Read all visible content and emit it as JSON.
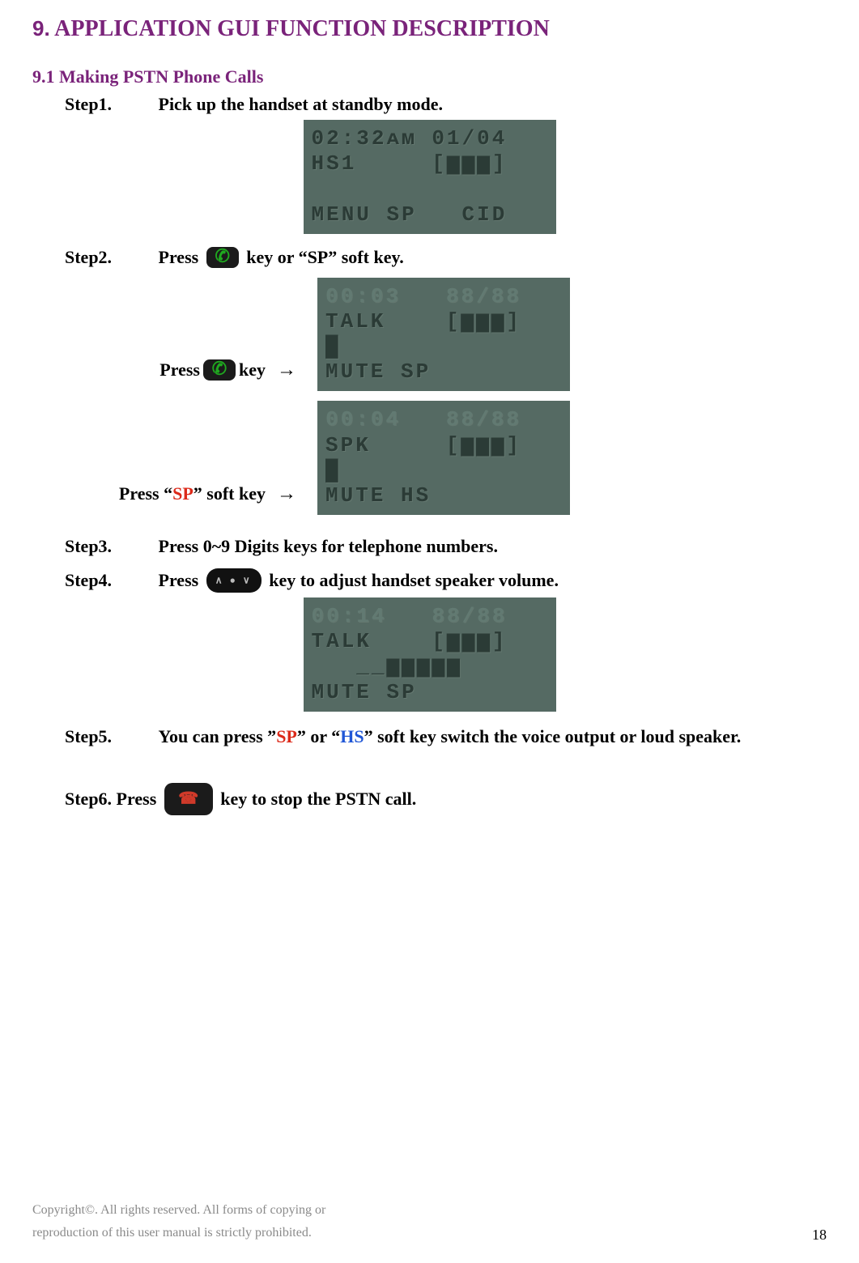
{
  "title_prefix": "9.",
  "title_text": " APPLICATION GUI FUNCTION DESCRIPTION",
  "subsection": "9.1 Making PSTN Phone Calls",
  "steps": {
    "s1_label": "Step1.",
    "s1_text": "Pick up the handset at standby mode.",
    "s2_label": "Step2.",
    "s2_pre": "Press",
    "s2_post": "key or “SP” soft key.",
    "s2a_pre": "Press ",
    "s2a_post": " key",
    "s2b_full_pre": "Press “",
    "s2b_sp": "SP",
    "s2b_full_post": "” soft key",
    "arrow": "→",
    "s3_label": "Step3.",
    "s3_text": "Press 0~9 Digits keys for telephone numbers.",
    "s4_label": "Step4.",
    "s4_pre": "Press ",
    "s4_post": " key to adjust handset speaker volume.",
    "s5_label": "Step5.",
    "s5_pre": "You can press ”",
    "s5_sp": "SP",
    "s5_mid": "” or “",
    "s5_hs": "HS",
    "s5_post": "” soft key switch the voice output or loud speaker.",
    "s6_pre": "Step6. Press ",
    "s6_post": " key to stop the PSTN call."
  },
  "screens": {
    "standby": {
      "l1": "02:32ᴀᴍ 01/04",
      "l2": "HS1     [▆▆▆]",
      "l3": "             ",
      "l4": "MENU SP   CID"
    },
    "talk": {
      "l1": "00:03   88/88",
      "l2": "TALK    [▆▆▆]",
      "l3": "█           ",
      "l4": "MUTE SP     "
    },
    "spk": {
      "l1": "00:04   88/88",
      "l2": "SPK     [▆▆▆]",
      "l3": "█           ",
      "l4": "MUTE HS     "
    },
    "volume": {
      "l1": "00:14   88/88",
      "l2": "TALK    [▆▆▆]",
      "l3": "   __▆▆▆▆▆   ",
      "l4": "MUTE SP     "
    }
  },
  "footer": {
    "l1": "Copyright©. All rights reserved. All forms of copying or",
    "l2": "reproduction of this user manual is strictly prohibited."
  },
  "page_number": "18"
}
